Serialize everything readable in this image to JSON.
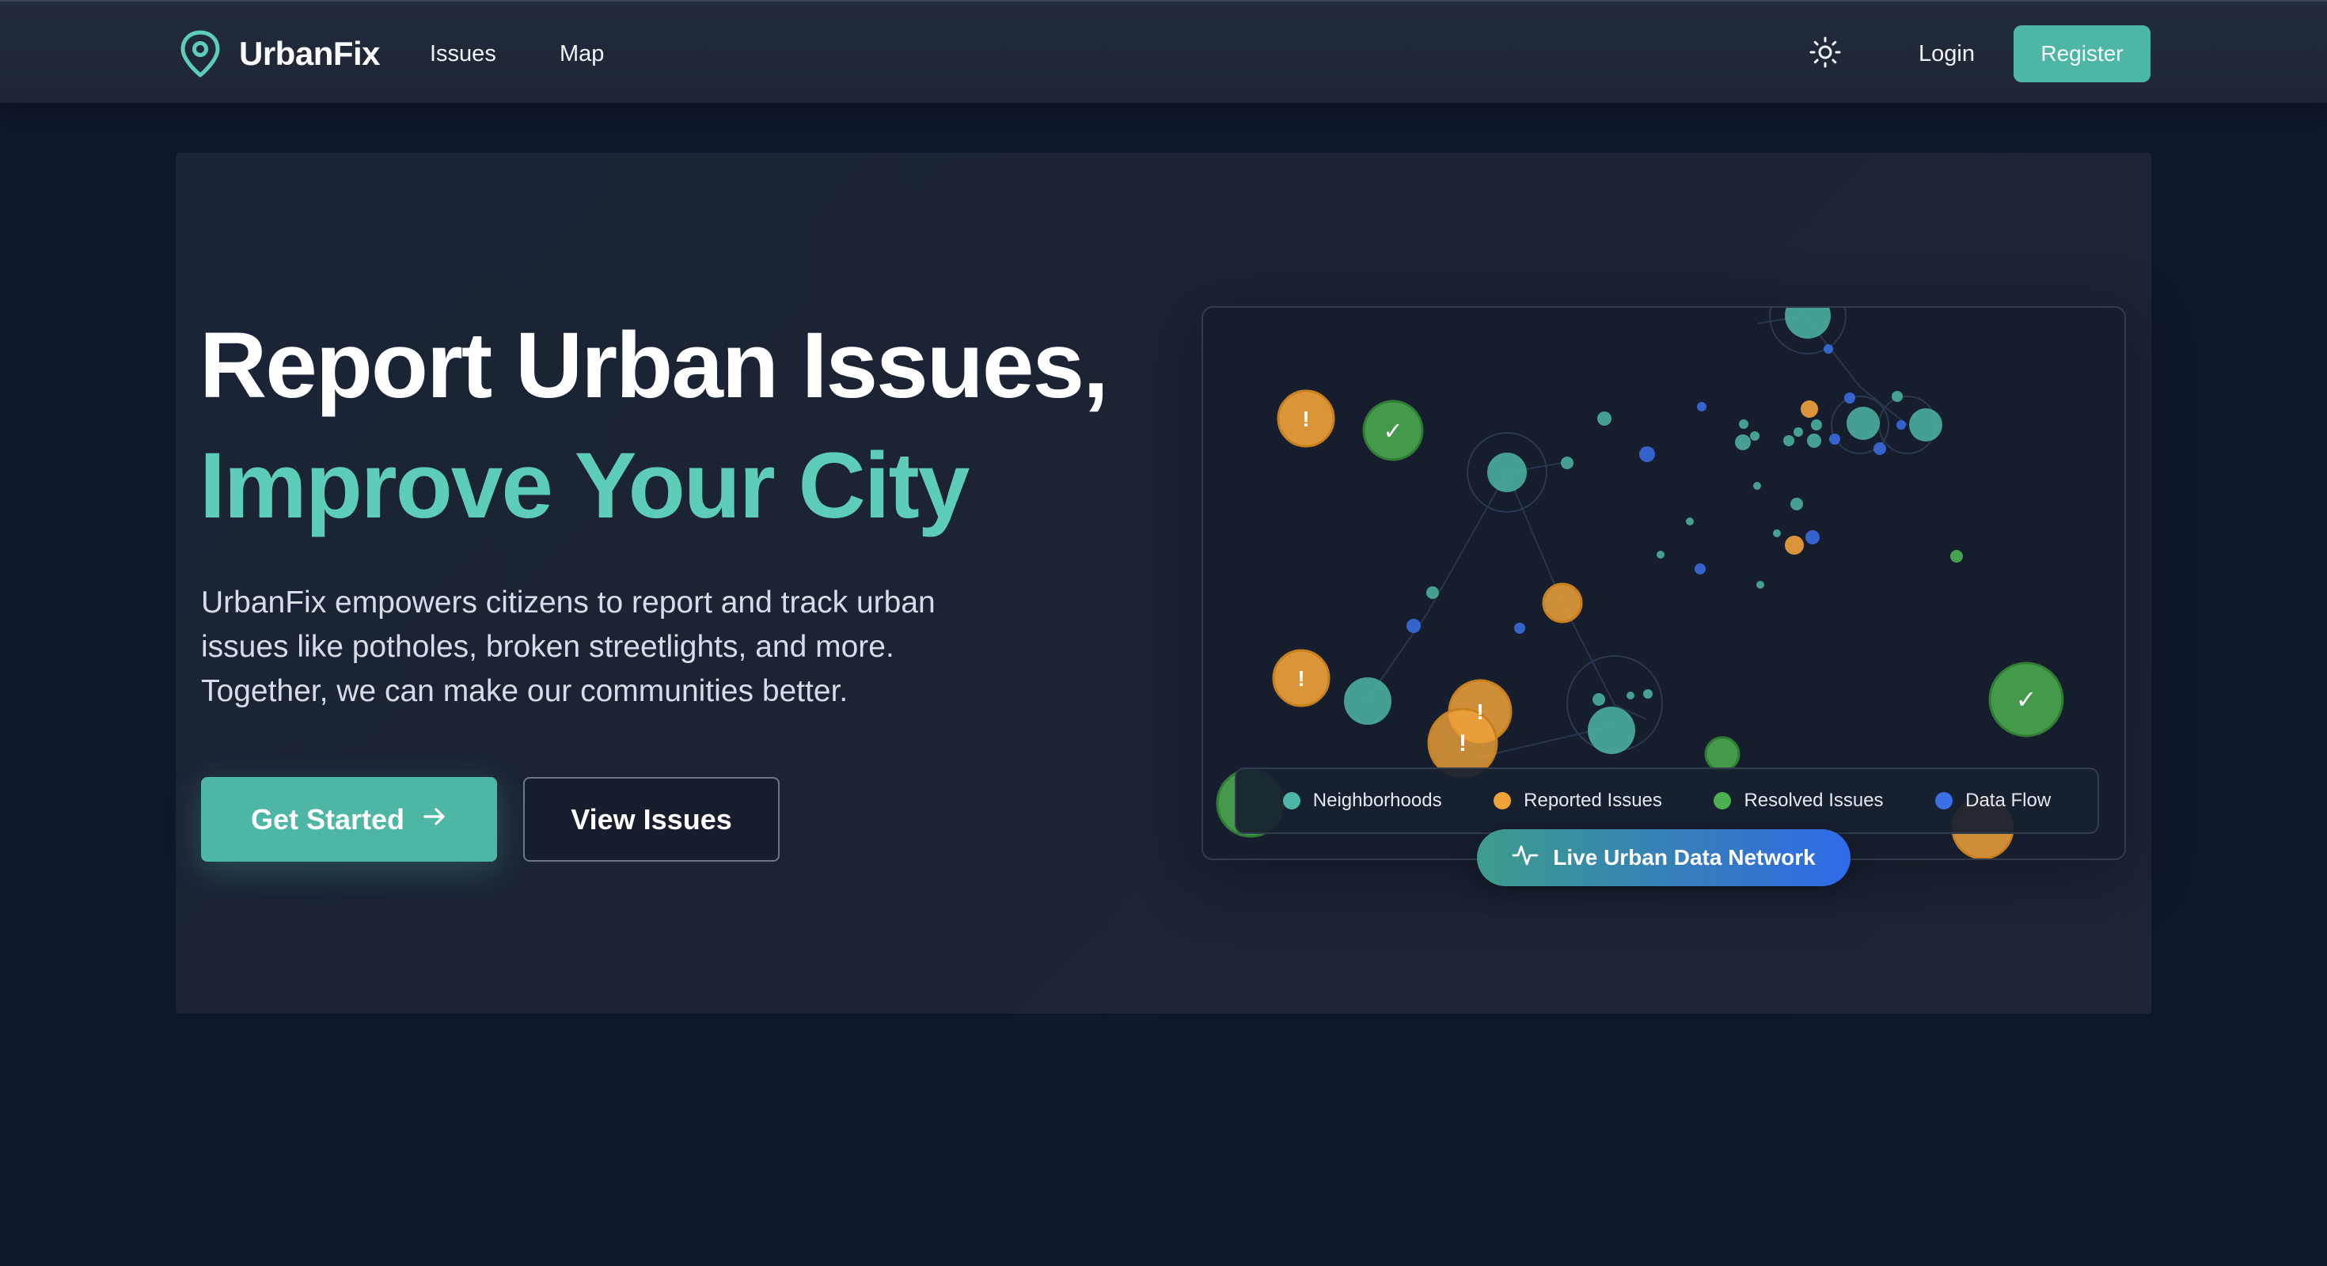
{
  "navbar": {
    "brand": "UrbanFix",
    "links": [
      "Issues",
      "Map"
    ],
    "login": "Login",
    "register": "Register",
    "theme_icon": "sun-icon"
  },
  "hero": {
    "headline_line1": "Report Urban Issues,",
    "headline_line2": "Improve Your City",
    "description": "UrbanFix empowers citizens to report and track urban issues like potholes, broken streetlights, and more. Together, we can make our communities better.",
    "primary_button": "Get Started",
    "primary_button_icon": "arrow-right-icon",
    "secondary_button": "View Issues"
  },
  "network": {
    "legend": [
      {
        "label": "Neighborhoods",
        "color": "#4db6a4"
      },
      {
        "label": "Reported Issues",
        "color": "#f0a23a"
      },
      {
        "label": "Resolved Issues",
        "color": "#4caf50"
      },
      {
        "label": "Data Flow",
        "color": "#3b6fe6"
      }
    ],
    "badge": "Live Urban Data Network",
    "badge_icon": "activity-icon",
    "reported_symbol": "!",
    "resolved_symbol": "✓"
  },
  "colors": {
    "accent": "#4db6a4",
    "headline_accent": "#5ecdb8",
    "background": "#0f172a",
    "navbar": "#1f2937",
    "reported": "#f0a23a",
    "resolved": "#4caf50",
    "data_flow": "#3b6fe6"
  }
}
